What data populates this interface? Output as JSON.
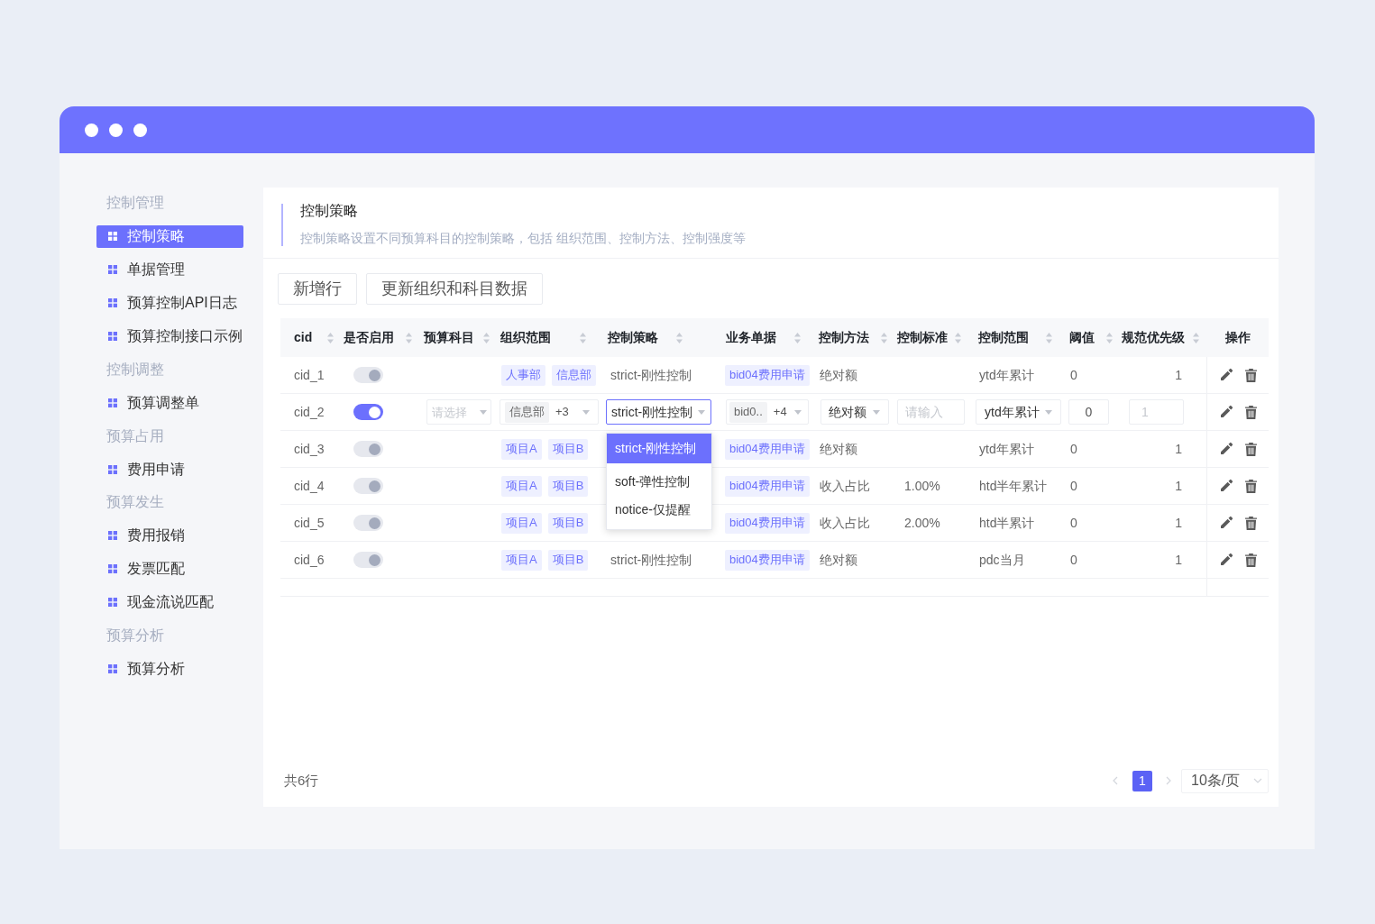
{
  "sidebar": {
    "groups": [
      {
        "label": "控制管理",
        "items": [
          {
            "label": "控制策略",
            "selected": true
          },
          {
            "label": "单据管理",
            "selected": false
          },
          {
            "label": "预算控制API日志",
            "selected": false
          },
          {
            "label": "预算控制接口示例",
            "selected": false
          }
        ]
      },
      {
        "label": "控制调整",
        "items": [
          {
            "label": "预算调整单",
            "selected": false
          }
        ]
      },
      {
        "label": "预算占用",
        "items": [
          {
            "label": "费用申请",
            "selected": false
          }
        ]
      },
      {
        "label": "预算发生",
        "items": [
          {
            "label": "费用报销",
            "selected": false
          },
          {
            "label": "发票匹配",
            "selected": false
          },
          {
            "label": "现金流说匹配",
            "selected": false
          }
        ]
      },
      {
        "label": "预算分析",
        "items": [
          {
            "label": "预算分析",
            "selected": false
          }
        ]
      }
    ]
  },
  "header": {
    "title": "控制策略",
    "description": "控制策略设置不同预算科目的控制策略，包括 组织范围、控制方法、控制强度等"
  },
  "toolbar": {
    "buttons": [
      {
        "label": "新增行"
      },
      {
        "label": "更新组织和科目数据"
      }
    ]
  },
  "table": {
    "columns": [
      {
        "label": "cid",
        "sortable": true
      },
      {
        "label": "是否启用",
        "sortable": true
      },
      {
        "label": "预算科目",
        "sortable": true
      },
      {
        "label": "组织范围",
        "sortable": true
      },
      {
        "label": "控制策略",
        "sortable": true
      },
      {
        "label": "业务单据",
        "sortable": true
      },
      {
        "label": "控制方法",
        "sortable": true
      },
      {
        "label": "控制标准",
        "sortable": true
      },
      {
        "label": "控制范围",
        "sortable": true
      },
      {
        "label": "阈值",
        "sortable": true
      },
      {
        "label": "规范优先级",
        "sortable": true
      },
      {
        "label": "操作",
        "sortable": false
      }
    ],
    "rows": [
      {
        "kind": "view",
        "cid": "cid_1",
        "enabled": true,
        "disabled": true,
        "org_scope": [
          "人事部",
          "信息部"
        ],
        "strategy": "strict-刚性控制",
        "documents": [
          "bid04费用申请"
        ],
        "method": "绝对额",
        "scope": "ytd年累计",
        "threshold": "0",
        "priority": "1"
      },
      {
        "kind": "edit",
        "cid": "cid_2",
        "enabled": true,
        "disabled": false,
        "subject": {
          "placeholder": "请选择"
        },
        "org_scope": {
          "tags": [
            "信息部"
          ],
          "more": "+3"
        },
        "strategy": {
          "value": "strict-刚性控制",
          "open": true,
          "options": [
            {
              "label": "strict-刚性控制",
              "selected": true
            },
            {
              "label": "soft-弹性控制",
              "selected": false
            },
            {
              "label": "notice-仅提醒",
              "selected": false
            }
          ]
        },
        "documents": {
          "tags": [
            "bid0.."
          ],
          "more": "+4"
        },
        "method": {
          "value": "绝对额"
        },
        "standard": {
          "placeholder": "请输入"
        },
        "scope": {
          "value": "ytd年累计"
        },
        "threshold": {
          "value": "0"
        },
        "priority": {
          "placeholder": "1"
        }
      },
      {
        "kind": "view",
        "cid": "cid_3",
        "enabled": true,
        "disabled": true,
        "org_scope": [
          "项目A",
          "项目B"
        ],
        "documents": [
          "bid04费用申请"
        ],
        "method": "绝对额",
        "scope": "ytd年累计",
        "threshold": "0",
        "priority": "1"
      },
      {
        "kind": "view",
        "cid": "cid_4",
        "enabled": true,
        "disabled": true,
        "org_scope": [
          "项目A",
          "项目B"
        ],
        "documents": [
          "bid04费用申请"
        ],
        "method": "收入占比",
        "standard": "1.00%",
        "scope": "htd半年累计",
        "threshold": "0",
        "priority": "1"
      },
      {
        "kind": "view",
        "cid": "cid_5",
        "enabled": true,
        "disabled": true,
        "org_scope": [
          "项目A",
          "项目B"
        ],
        "documents": [
          "bid04费用申请"
        ],
        "method": "收入占比",
        "standard": "2.00%",
        "scope": "htd半累计",
        "threshold": "0",
        "priority": "1"
      },
      {
        "kind": "view",
        "cid": "cid_6",
        "enabled": true,
        "disabled": true,
        "org_scope": [
          "项目A",
          "项目B"
        ],
        "strategy": "strict-刚性控制",
        "documents": [
          "bid04费用申请"
        ],
        "method": "绝对额",
        "scope": "pdc当月",
        "threshold": "0",
        "priority": "1"
      }
    ]
  },
  "footer": {
    "total": "共6行",
    "pagination": {
      "pages": [
        {
          "label": "1",
          "selected": true
        }
      ],
      "page_size": "10条/页"
    }
  }
}
